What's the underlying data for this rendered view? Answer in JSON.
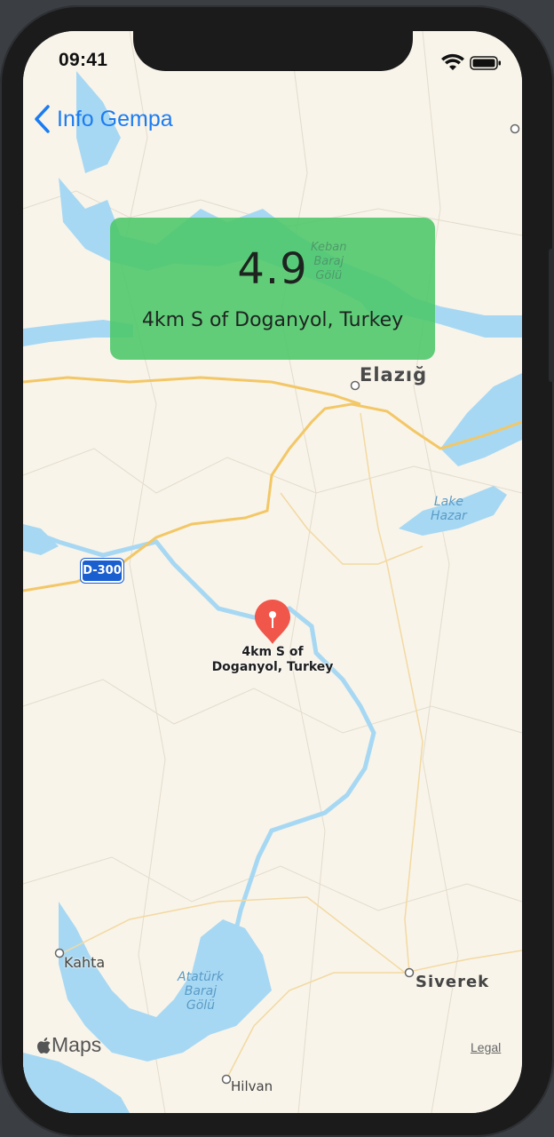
{
  "status_bar": {
    "time": "09:41"
  },
  "nav": {
    "back_label": "Info Gempa"
  },
  "card": {
    "magnitude": "4.9",
    "location": "4km S of Doganyol, Turkey",
    "color": "#4cc769"
  },
  "pin": {
    "label_line1": "4km S of",
    "label_line2": "Doganyol, Turkey",
    "color": "#f0574a"
  },
  "map": {
    "cities": [
      "Elazığ",
      "Kahta",
      "Siverek",
      "Hilvan"
    ],
    "water": {
      "keban": [
        "Keban",
        "Baraj",
        "Gölü"
      ],
      "hazar": [
        "Lake",
        "Hazar"
      ],
      "ataturk": [
        "Atatürk",
        "Baraj",
        "Gölü"
      ]
    },
    "road_shield": "D-300"
  },
  "attribution": {
    "maps_label": "Maps",
    "legal_label": "Legal"
  }
}
